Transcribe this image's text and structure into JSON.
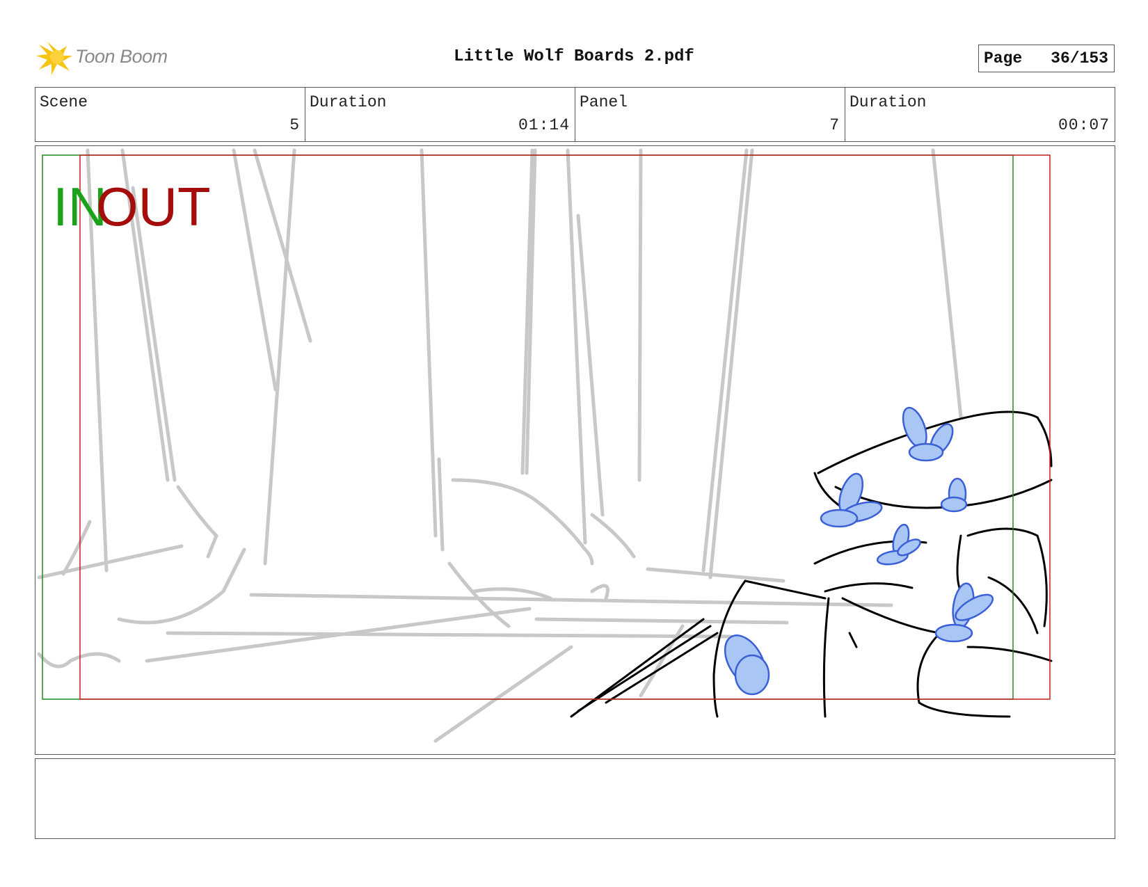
{
  "header": {
    "brand": "Toon Boom",
    "document_title": "Little Wolf Boards 2.pdf",
    "page_label": "Page",
    "page_number": "36/153"
  },
  "info": {
    "scene_label": "Scene",
    "scene_value": "5",
    "scene_duration_label": "Duration",
    "scene_duration_value": "01:14",
    "panel_label": "Panel",
    "panel_value": "7",
    "panel_duration_label": "Duration",
    "panel_duration_value": "00:07"
  },
  "panel": {
    "in_label": "IN",
    "out_label": "OUT",
    "in_color": "#1aa31a",
    "out_color": "#a50c0c",
    "butterfly_color": "#5b8fe0",
    "sketch_color": "#c8c8c8"
  },
  "caption": {
    "text": ""
  }
}
